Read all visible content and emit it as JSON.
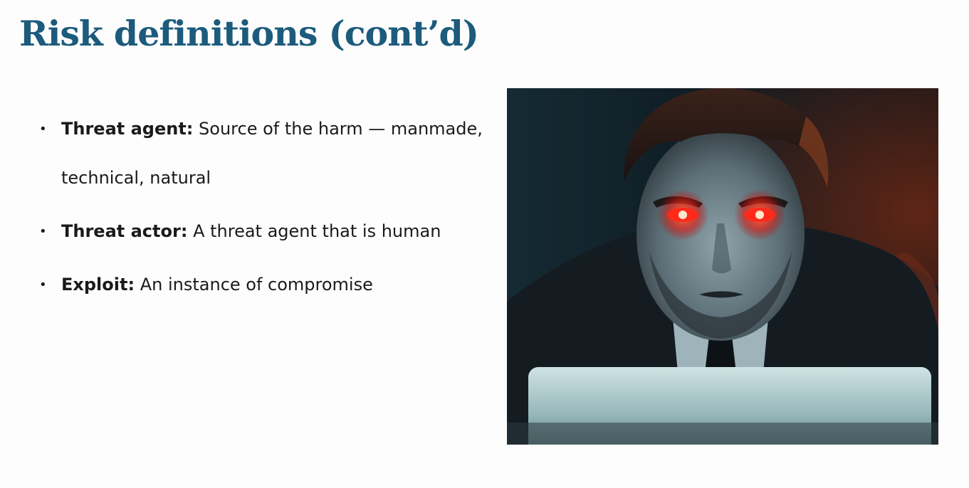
{
  "slide": {
    "title": "Risk definitions (cont’d)",
    "bullets": [
      {
        "term": "Threat agent:",
        "text": "Source of the harm — manmade, technical, natural"
      },
      {
        "term": "Threat actor:",
        "text": "A threat agent that is human"
      },
      {
        "term": "Exploit:",
        "text": "An instance of compromise"
      }
    ],
    "bullet_glyph": "•"
  },
  "colors": {
    "title": "#1c5b7c",
    "body_text": "#1a1a1a",
    "background": "#fdfdfd",
    "eye_glow": "#ff2a1a"
  }
}
